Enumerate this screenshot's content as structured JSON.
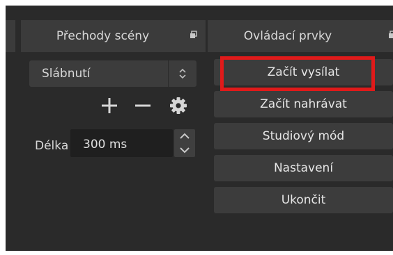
{
  "docks": {
    "transitions_title": "Přechody scény",
    "controls_title": "Ovládací prvky"
  },
  "transitions": {
    "selected": "Slábnutí",
    "duration_label": "Délka",
    "duration_value": "300 ms"
  },
  "controls": {
    "buttons": [
      "Začít vysílat",
      "Začít nahrávat",
      "Studiový mód",
      "Nastavení",
      "Ukončit"
    ]
  },
  "colors": {
    "highlight": "#e01a1a",
    "panel_bg": "#2a2a2a",
    "button_bg": "#3c3c3c"
  },
  "icons": [
    "float-icon",
    "updown-arrows-icon",
    "plus-icon",
    "minus-icon",
    "gear-icon",
    "chevron-up-icon",
    "chevron-down-icon"
  ]
}
